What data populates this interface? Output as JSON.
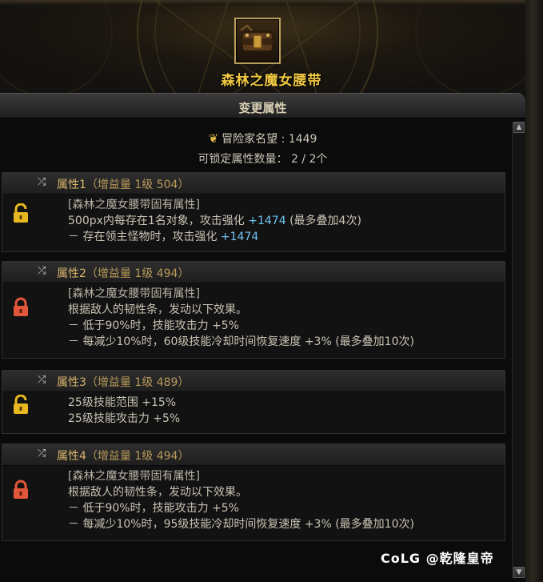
{
  "item": {
    "name": "森林之魔女腰带",
    "icon": "belt-icon"
  },
  "section": {
    "title": "变更属性"
  },
  "info": {
    "reputation_label": "冒险家名望",
    "reputation_value": ": 1449",
    "lockable_label": "可锁定属性数量：",
    "lockable_value": "2 / 2个"
  },
  "attributes": [
    {
      "title": "属性1",
      "sub": "（增益量 1级 504）",
      "locked": false,
      "lines": [
        {
          "text": "[森林之魔女腰带固有属性]",
          "bonus": ""
        },
        {
          "text": "500px内每存在1名对象，攻击强化 ",
          "bonus": "+1474",
          "tail": " (最多叠加4次)"
        },
        {
          "text": "－ 存在领主怪物时，攻击强化 ",
          "bonus": "+1474",
          "tail": ""
        }
      ]
    },
    {
      "title": "属性2",
      "sub": "（增益量 1级 494）",
      "locked": true,
      "lines": [
        {
          "text": "[森林之魔女腰带固有属性]"
        },
        {
          "text": "根据敌人的韧性条，发动以下效果。"
        },
        {
          "text": "－ 低于90%时，技能攻击力 +5%"
        },
        {
          "text": "－ 每减少10%时，60级技能冷却时间恢复速度 +3% (最多叠加10次)"
        }
      ]
    },
    {
      "title": "属性3",
      "sub": "（增益量 1级 489）",
      "locked": false,
      "lines": [
        {
          "text": "25级技能范围 +15%"
        },
        {
          "text": "25级技能攻击力 +5%"
        }
      ]
    },
    {
      "title": "属性4",
      "sub": "（增益量 1级 494）",
      "locked": true,
      "lines": [
        {
          "text": "[森林之魔女腰带固有属性]"
        },
        {
          "text": "根据敌人的韧性条，发动以下效果。"
        },
        {
          "text": "－ 低于90%时，技能攻击力 +5%"
        },
        {
          "text": "－ 每减少10%时，95级技能冷却时间恢复速度 +3% (最多叠加10次)"
        }
      ]
    }
  ],
  "watermark": "CoLG @乾隆皇帝",
  "colors": {
    "gold": "#f0c842",
    "attr_title": "#d8b56a",
    "bonus_blue": "#6fc3f2",
    "lock_unlocked": "#e8b820",
    "lock_locked": "#e2573a"
  }
}
